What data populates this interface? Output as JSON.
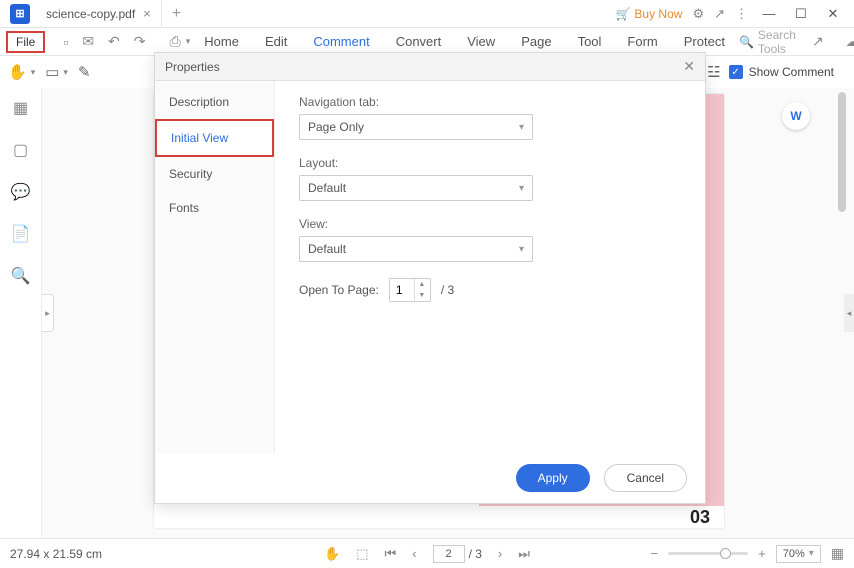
{
  "titlebar": {
    "app_glyph": "⊞",
    "tab_name": "science-copy.pdf",
    "buy_now": "Buy Now"
  },
  "menubar": {
    "file": "File",
    "items": [
      "Home",
      "Edit",
      "Comment",
      "Convert",
      "View",
      "Page",
      "Tool",
      "Form",
      "Protect"
    ],
    "active_index": 2,
    "search_placeholder": "Search Tools"
  },
  "toolbar": {
    "show_comment": "Show Comment"
  },
  "properties": {
    "title": "Properties",
    "tabs": [
      "Description",
      "Initial View",
      "Security",
      "Fonts"
    ],
    "active_tab": 1,
    "nav_label": "Navigation tab:",
    "nav_value": "Page Only",
    "layout_label": "Layout:",
    "layout_value": "Default",
    "view_label": "View:",
    "view_value": "Default",
    "open_label": "Open To Page:",
    "open_value": "1",
    "open_total": "/ 3",
    "apply": "Apply",
    "cancel": "Cancel"
  },
  "document": {
    "page_num": "03",
    "word_badge": "W"
  },
  "statusbar": {
    "dimensions": "27.94 x 21.59 cm",
    "page_current": "2",
    "page_total": "/ 3",
    "zoom": "70%"
  }
}
